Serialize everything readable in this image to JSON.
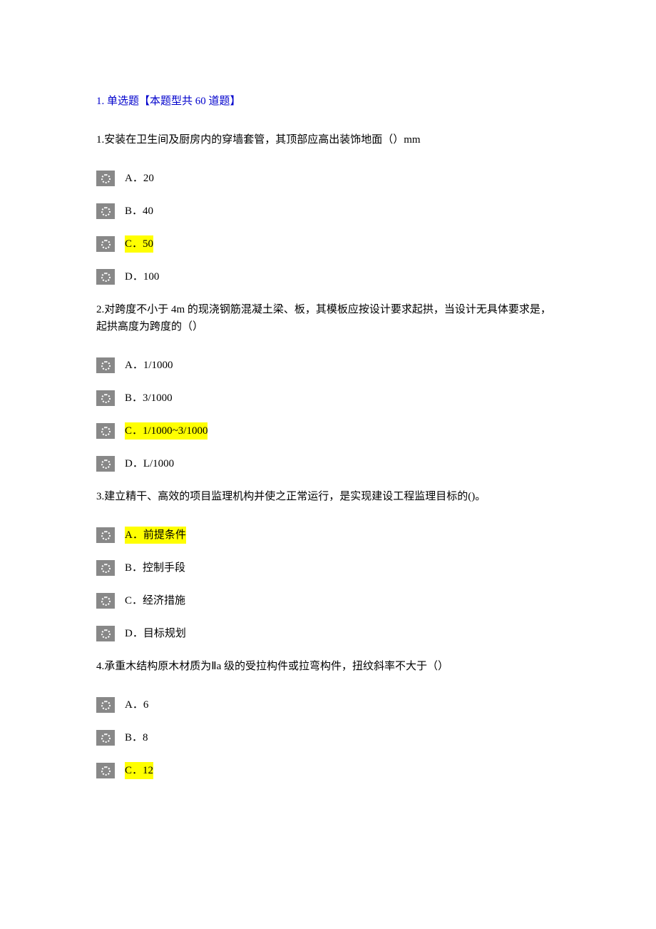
{
  "section_title": "1. 单选题【本题型共 60 道题】",
  "questions": [
    {
      "text": "1.安装在卫生间及厨房内的穿墙套管，其顶部应高出装饰地面（）mm",
      "options": [
        {
          "label": "A．20",
          "highlighted": false
        },
        {
          "label": "B．40",
          "highlighted": false
        },
        {
          "label": "C．50",
          "highlighted": true
        },
        {
          "label": "D．100",
          "highlighted": false
        }
      ]
    },
    {
      "text": "2.对跨度不小于 4m 的现浇钢筋混凝土梁、板，其模板应按设计要求起拱，当设计无具体要求是，起拱高度为跨度的（）",
      "options": [
        {
          "label": "A．1/1000",
          "highlighted": false
        },
        {
          "label": "B．3/1000",
          "highlighted": false
        },
        {
          "label": "C．1/1000~3/1000",
          "highlighted": true
        },
        {
          "label": "D．L/1000",
          "highlighted": false
        }
      ]
    },
    {
      "text": "3.建立精干、高效的项目监理机构并使之正常运行，是实现建设工程监理目标的()。",
      "options": [
        {
          "label": "A．前提条件",
          "highlighted": true
        },
        {
          "label": "B．控制手段",
          "highlighted": false
        },
        {
          "label": "C．经济措施",
          "highlighted": false
        },
        {
          "label": "D．目标规划",
          "highlighted": false
        }
      ]
    },
    {
      "text": "4.承重木结构原木材质为Ⅱa 级的受拉构件或拉弯构件，扭纹斜率不大于（）",
      "options": [
        {
          "label": "A．6",
          "highlighted": false
        },
        {
          "label": "B．8",
          "highlighted": false
        },
        {
          "label": "C．12",
          "highlighted": true
        }
      ]
    }
  ]
}
